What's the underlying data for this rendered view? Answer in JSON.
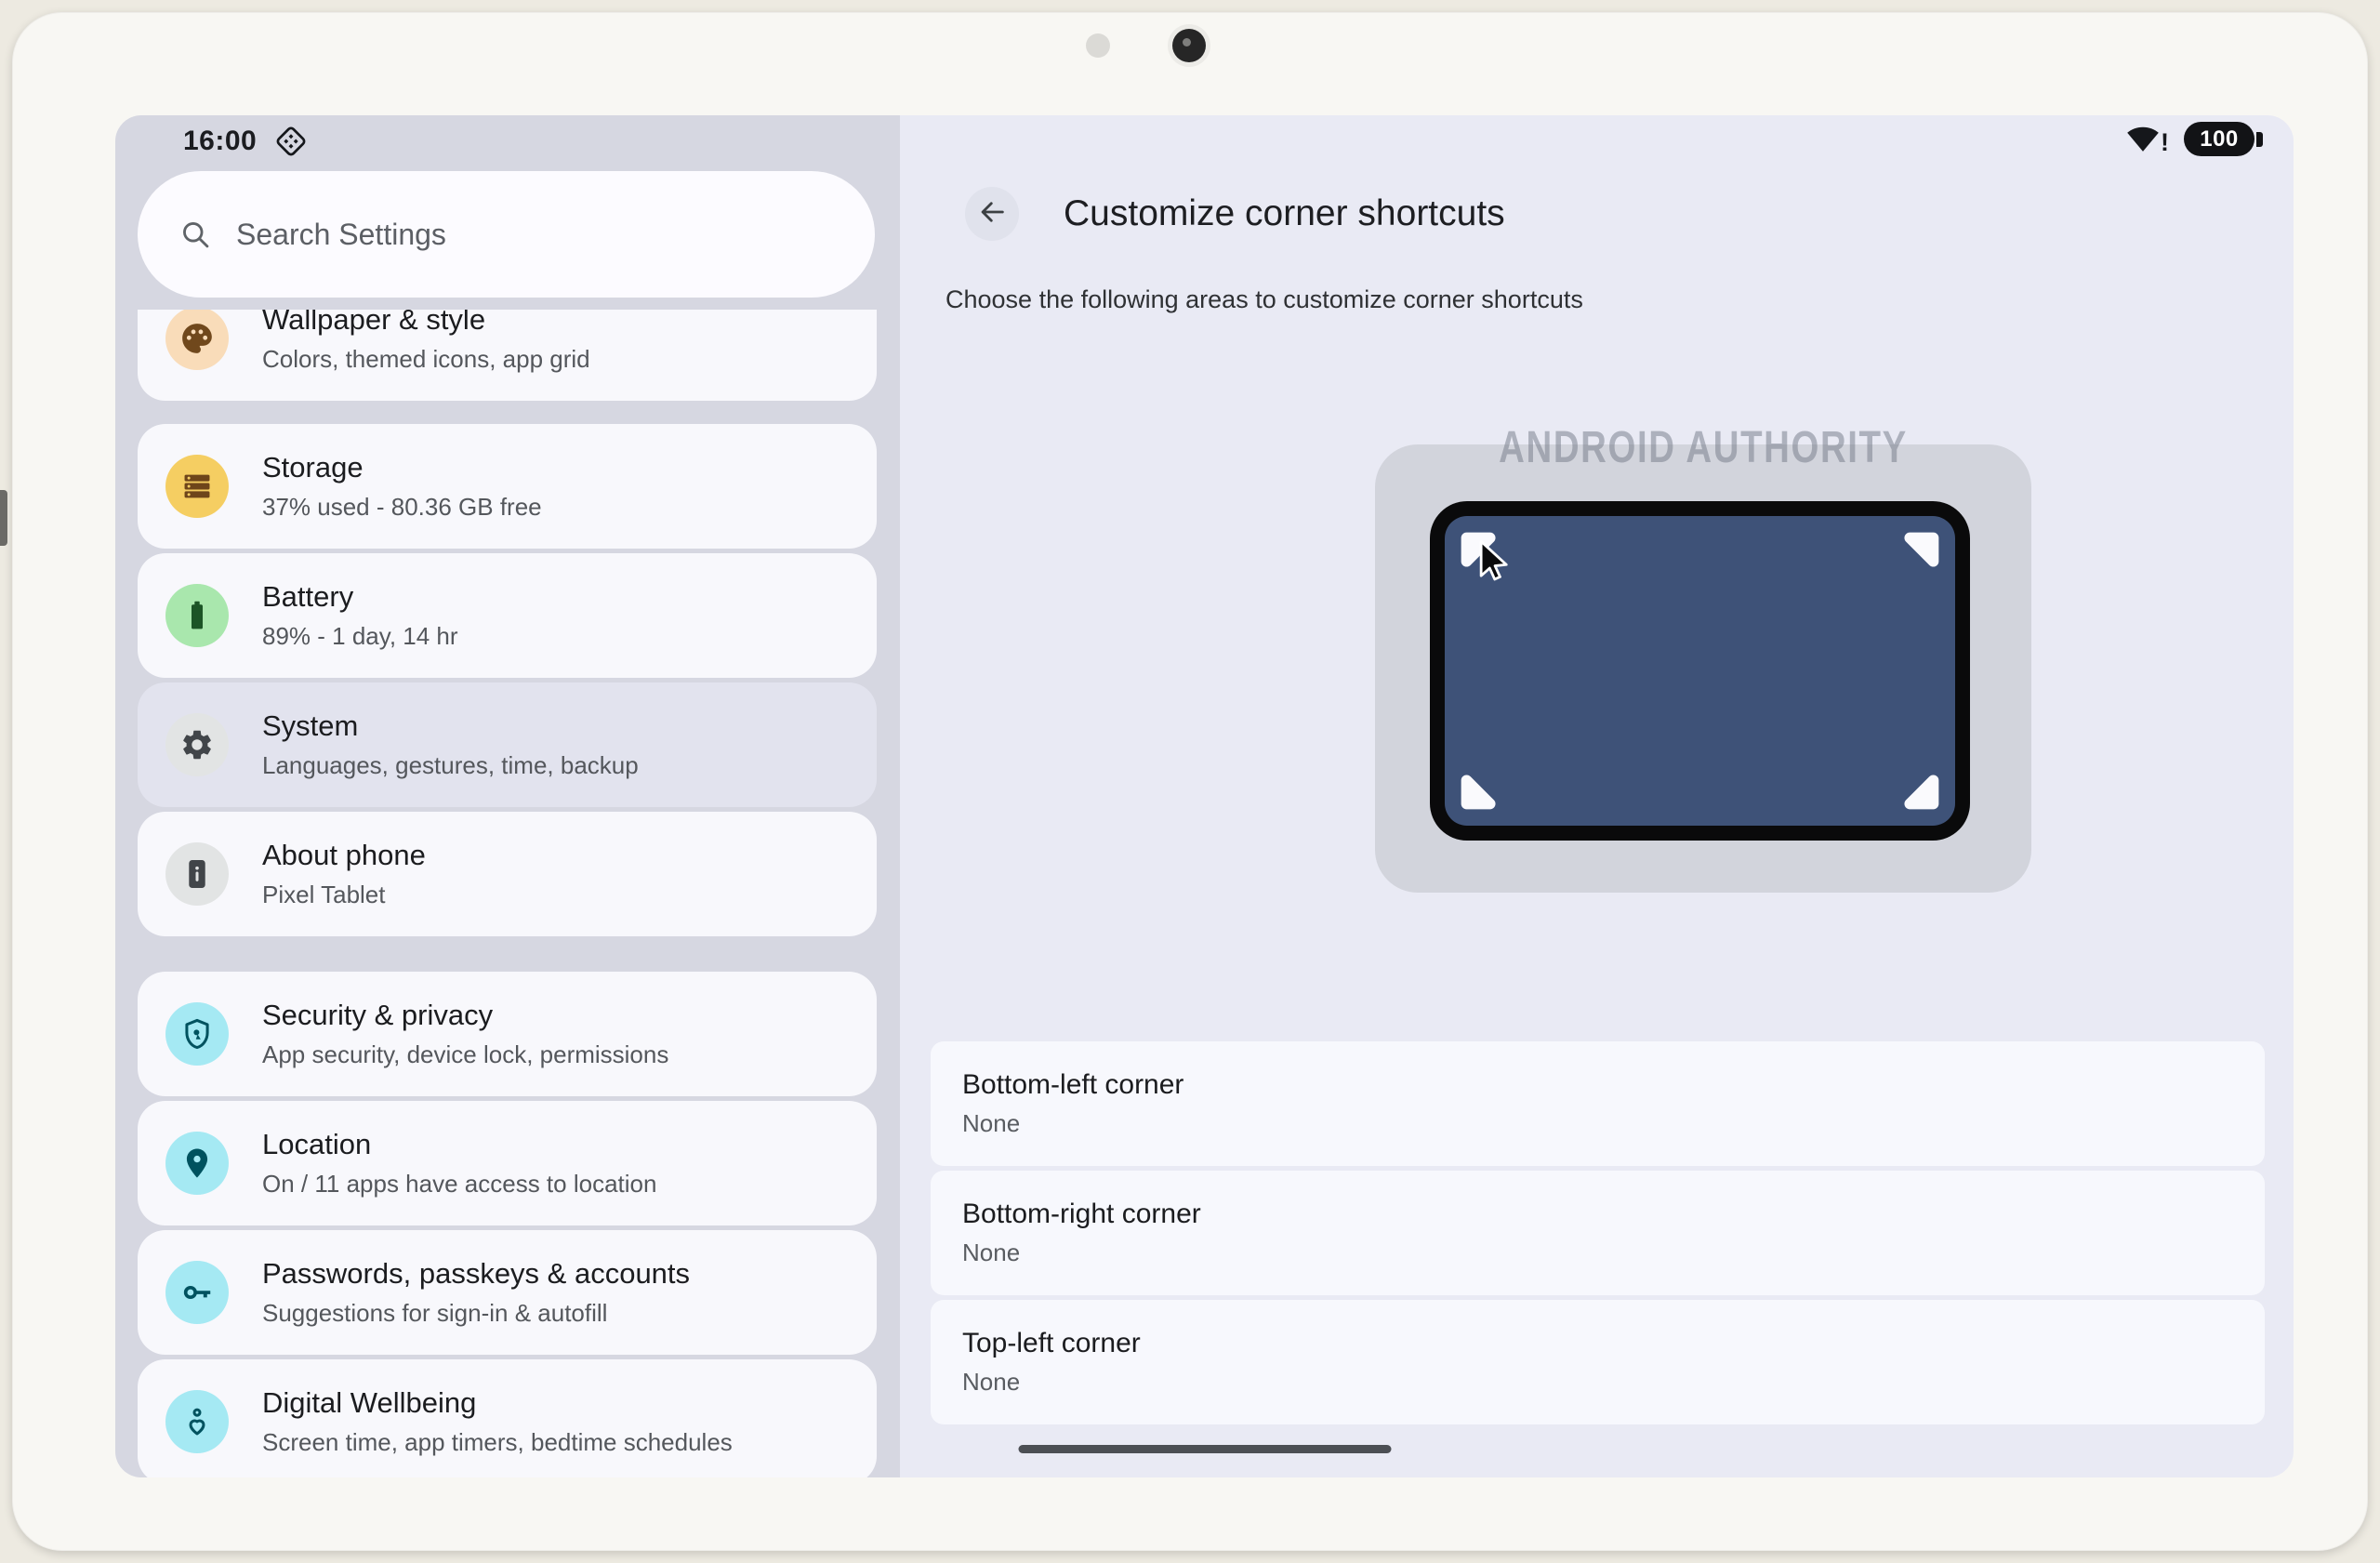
{
  "status_bar": {
    "time": "16:00",
    "battery": "100",
    "wifi_alert": "!"
  },
  "search": {
    "placeholder": "Search Settings"
  },
  "settings_list": [
    {
      "title": "Wallpaper & style",
      "subtitle": "Colors, themed icons, app grid",
      "icon": "palette-icon",
      "selected": false
    },
    {
      "title": "Storage",
      "subtitle": "37% used - 80.36 GB free",
      "icon": "storage-icon",
      "selected": false
    },
    {
      "title": "Battery",
      "subtitle": "89% - 1 day, 14 hr",
      "icon": "battery-icon",
      "selected": false
    },
    {
      "title": "System",
      "subtitle": "Languages, gestures, time, backup",
      "icon": "gear-icon",
      "selected": true
    },
    {
      "title": "About phone",
      "subtitle": "Pixel Tablet",
      "icon": "phone-info-icon",
      "selected": false
    },
    {
      "title": "Security & privacy",
      "subtitle": "App security, device lock, permissions",
      "icon": "shield-icon",
      "selected": false
    },
    {
      "title": "Location",
      "subtitle": "On / 11 apps have access to location",
      "icon": "location-pin-icon",
      "selected": false
    },
    {
      "title": "Passwords, passkeys & accounts",
      "subtitle": "Suggestions for sign-in & autofill",
      "icon": "key-icon",
      "selected": false
    },
    {
      "title": "Digital Wellbeing",
      "subtitle": "Screen time, app timers, bedtime schedules",
      "icon": "wellbeing-icon",
      "selected": false
    }
  ],
  "detail": {
    "title": "Customize corner shortcuts",
    "description": "Choose the following areas to customize corner shortcuts",
    "watermark": "ANDROID AUTHORITY",
    "corner_options": [
      {
        "label": "Bottom-left corner",
        "value": "None"
      },
      {
        "label": "Bottom-right corner",
        "value": "None"
      },
      {
        "label": "Top-left corner",
        "value": "None"
      }
    ]
  },
  "colors": {
    "frame_beige": "#EDEAE1",
    "bezel": "#F8F7F3",
    "left_panel_bg": "#D6D7E1",
    "right_panel_bg": "#E9EAF4",
    "card_bg": "#F8F8FC",
    "selected_card_bg": "#E2E3EE",
    "illustration_bg": "#D2D4DC",
    "mini_tablet_screen": "#3E5278",
    "accent_cyan": "#A5E9F3",
    "accent_teal": "#00525F",
    "gesture_pill": "#4C4F54"
  }
}
